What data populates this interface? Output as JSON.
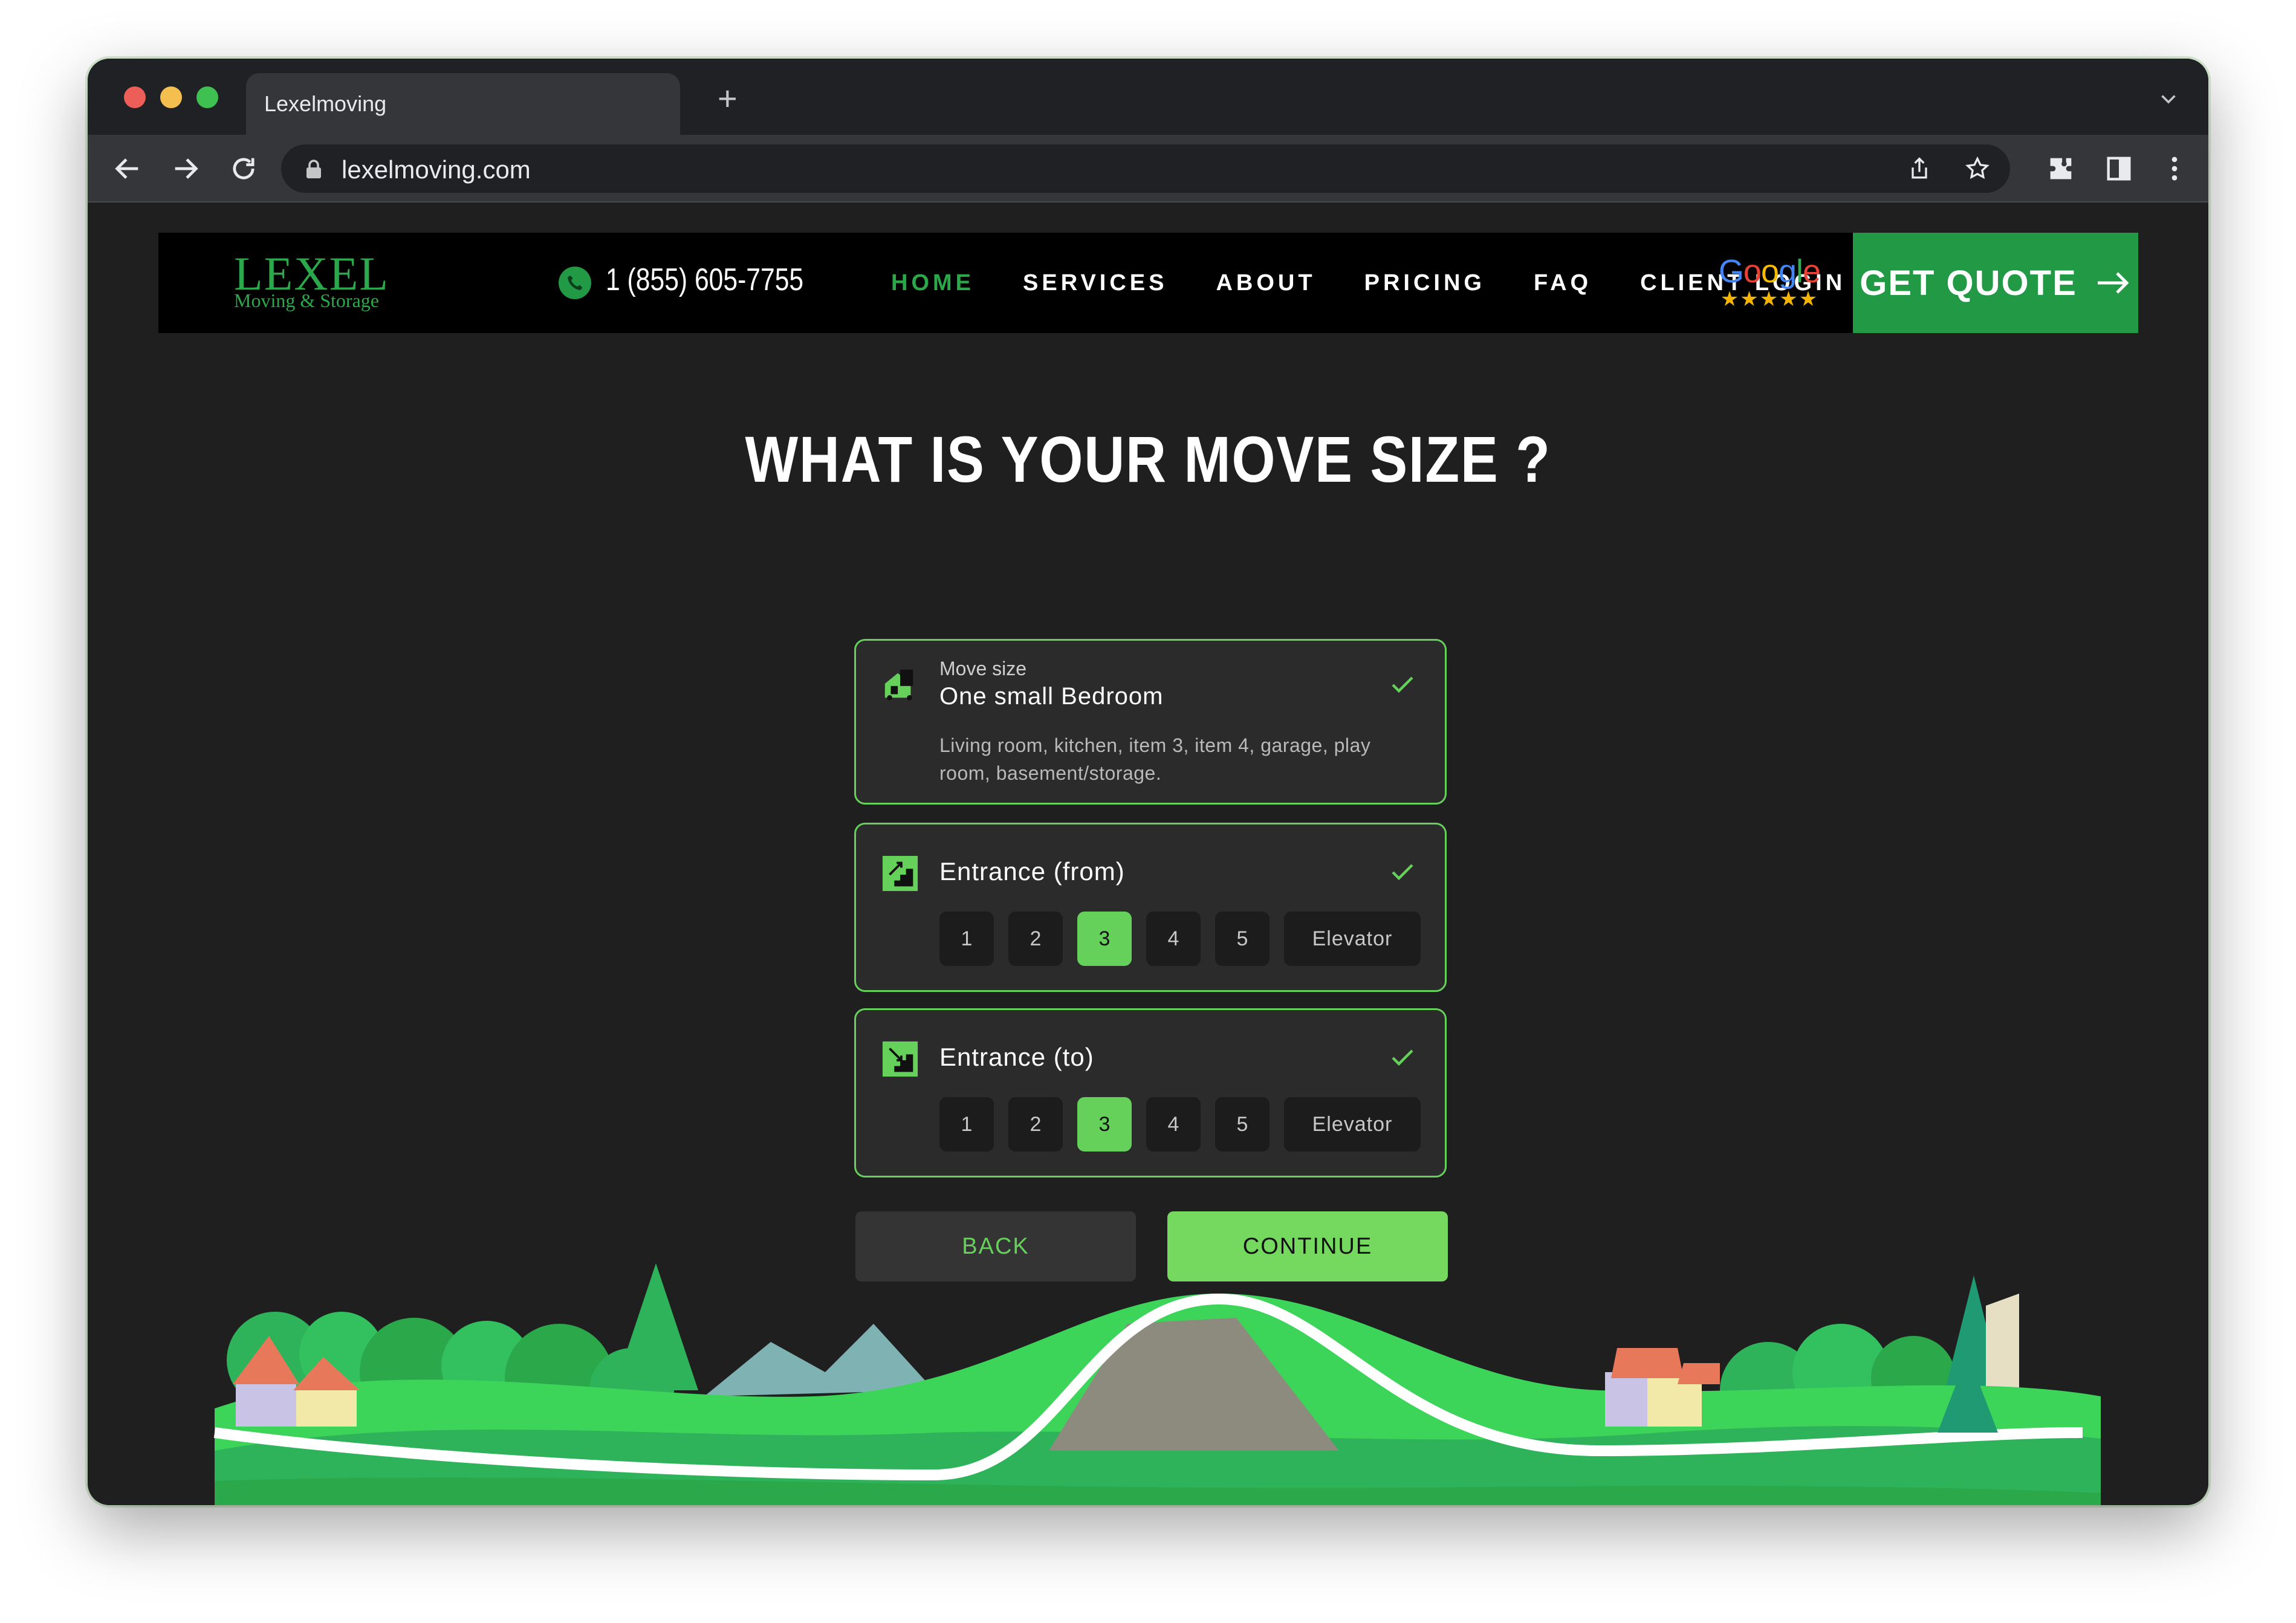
{
  "browser": {
    "tab_title": "Lexelmoving",
    "url": "lexelmoving.com",
    "new_tab_label": "+"
  },
  "header": {
    "logo_main": "LEXEL",
    "logo_sub": "Moving & Storage",
    "phone": "1 (855) 605-7755",
    "menu": [
      "HOME",
      "SERVICES",
      "ABOUT",
      "PRICING",
      "FAQ",
      "CLIENT LOGIN"
    ],
    "active_menu": "HOME",
    "google_word": "Google",
    "google_stars": "★★★★★",
    "cta": "GET QUOTE"
  },
  "form": {
    "title": "WHAT IS YOUR MOVE SIZE ?",
    "move_size": {
      "label": "Move size",
      "value": "One small Bedroom",
      "description": "Living room, kitchen, item 3, item 4, garage, play room, basement/storage."
    },
    "entrance_from": {
      "title": "Entrance (from)",
      "options": [
        "1",
        "2",
        "3",
        "4",
        "5",
        "Elevator"
      ],
      "selected": "3"
    },
    "entrance_to": {
      "title": "Entrance (to)",
      "options": [
        "1",
        "2",
        "3",
        "4",
        "5",
        "Elevator"
      ],
      "selected": "3"
    },
    "back_label": "BACK",
    "continue_label": "CONTINUE"
  },
  "colors": {
    "accent": "#66d15a",
    "brand_green": "#229944",
    "page_bg": "#1f1f1f",
    "header_bg": "#000000"
  }
}
